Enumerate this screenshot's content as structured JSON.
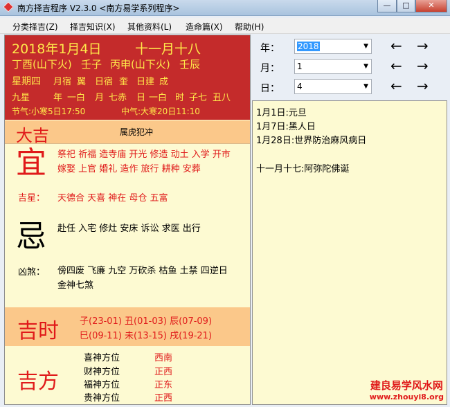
{
  "window": {
    "title": "南方择吉程序 V2.3.0 <南方易学系列程序>",
    "min_glyph": "—",
    "max_glyph": "□",
    "close_glyph": "✕"
  },
  "menu": [
    "分类择吉(Z)",
    "择吉知识(X)",
    "其他资料(L)",
    "造命篇(X)",
    "帮助(H)"
  ],
  "date": {
    "gregorian": "2018年1月4日",
    "lunar": "十一月十八",
    "ganzhi": [
      "丁酉(山下火)",
      "壬子",
      "丙申(山下火)",
      "壬辰"
    ],
    "weekday": "星期四",
    "line2": [
      "月宿",
      "翼",
      "日宿",
      "奎",
      "日建",
      "成"
    ],
    "jiuxing": [
      "九星",
      "年",
      "一白",
      "月",
      "七赤",
      "日",
      "一白",
      "时",
      "子七",
      "丑八"
    ],
    "jieqi_prev": "节气:小寒5日17:50",
    "jieqi_next": "中气:大寒20日11:10"
  },
  "fortune": {
    "label": "大吉",
    "chong": "属虎犯冲"
  },
  "yi": {
    "char": "宜",
    "line1": "祭祀 祈福 造寺庙 开光 修造 动土 入学 开市",
    "line2": "嫁娶 上官 婚礼 造作 旅行 耕种 安葬",
    "jixing_label": "吉星：",
    "jixing": "天德合 天喜 神在 母仓 五富"
  },
  "ji": {
    "char": "忌",
    "line1": "赴任 入宅 修灶 安床 诉讼 求医 出行",
    "xiongsha_label": "凶煞：",
    "xiongsha1": "傍四废 飞廉 九空 万砍杀 枯鱼 土禁 四逆日",
    "xiongsha2": "金神七煞"
  },
  "jishi": {
    "label": "吉时",
    "line1": "子(23-01) 丑(01-03) 辰(07-09)",
    "line2": "巳(09-11) 未(13-15) 戌(19-21)"
  },
  "jifang": {
    "label": "吉方",
    "items": [
      {
        "name": "喜神方位",
        "dir": "西南"
      },
      {
        "name": "财神方位",
        "dir": "正西"
      },
      {
        "name": "福神方位",
        "dir": "正东"
      },
      {
        "name": "贵神方位",
        "dir": "正西"
      }
    ]
  },
  "controls": {
    "year_label": "年：",
    "year_value": "2018",
    "month_label": "月：",
    "month_value": "1",
    "day_label": "日：",
    "day_value": "4",
    "prev_glyph": "←",
    "next_glyph": "→"
  },
  "notes": [
    "1月1日:元旦",
    "1月7日:黑人日",
    "1月28日:世界防治麻风病日",
    "十一月十七:阿弥陀佛诞"
  ],
  "watermark": {
    "line1": "建良易学风水网",
    "line2": "www.zhouyi8.org"
  },
  "colors": {
    "accent_red": "#c42b2b",
    "gold": "#ffe84a",
    "band": "#fbc88a",
    "paper": "#fdfad2"
  }
}
